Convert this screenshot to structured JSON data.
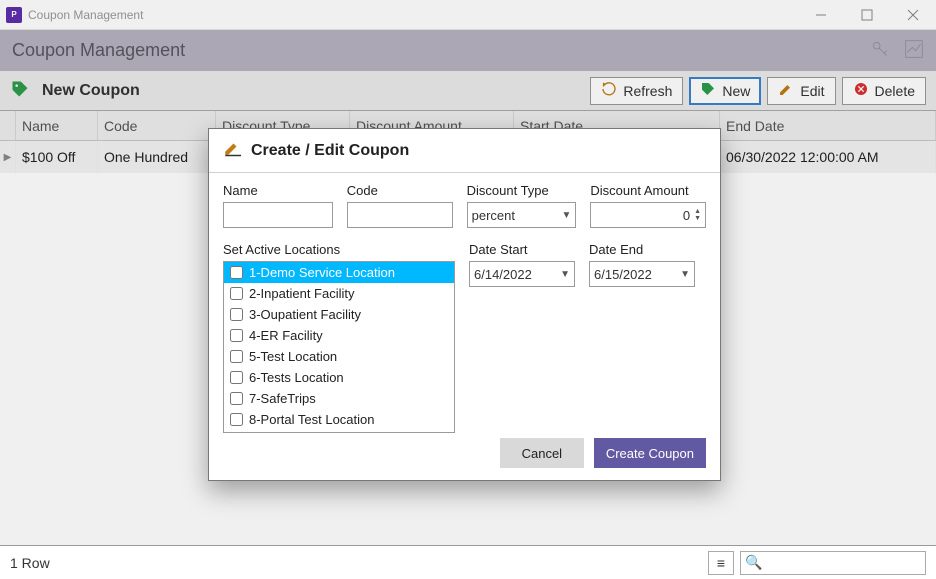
{
  "window": {
    "title": "Coupon Management"
  },
  "ribbon": {
    "heading": "Coupon Management"
  },
  "toolbar": {
    "page_label": "New Coupon",
    "refresh": "Refresh",
    "new": "New",
    "edit": "Edit",
    "delete": "Delete"
  },
  "grid": {
    "columns": {
      "name": "Name",
      "code": "Code",
      "type": "Discount Type",
      "amount": "Discount Amount",
      "start": "Start Date",
      "end": "End Date"
    },
    "rows": [
      {
        "name": "$100 Off",
        "code": "One Hundred",
        "type": "",
        "amount": "",
        "start": "",
        "end": "06/30/2022 12:00:00 AM"
      }
    ]
  },
  "statusbar": {
    "row_count": "1 Row"
  },
  "modal": {
    "title": "Create / Edit Coupon",
    "labels": {
      "name": "Name",
      "code": "Code",
      "type": "Discount Type",
      "amount": "Discount Amount",
      "locations": "Set Active Locations",
      "date_start": "Date Start",
      "date_end": "Date End"
    },
    "values": {
      "name": "",
      "code": "",
      "type": "percent",
      "amount": "0",
      "date_start": "6/14/2022",
      "date_end": "6/15/2022"
    },
    "locations": [
      {
        "label": "1-Demo Service Location",
        "checked": false,
        "selected": true
      },
      {
        "label": "2-Inpatient Facility",
        "checked": false,
        "selected": false
      },
      {
        "label": "3-Oupatient Facility",
        "checked": false,
        "selected": false
      },
      {
        "label": "4-ER Facility",
        "checked": false,
        "selected": false
      },
      {
        "label": "5-Test Location",
        "checked": false,
        "selected": false
      },
      {
        "label": "6-Tests Location",
        "checked": false,
        "selected": false
      },
      {
        "label": "7-SafeTrips",
        "checked": false,
        "selected": false
      },
      {
        "label": "8-Portal Test Location",
        "checked": false,
        "selected": false
      }
    ],
    "buttons": {
      "cancel": "Cancel",
      "create": "Create Coupon"
    }
  }
}
